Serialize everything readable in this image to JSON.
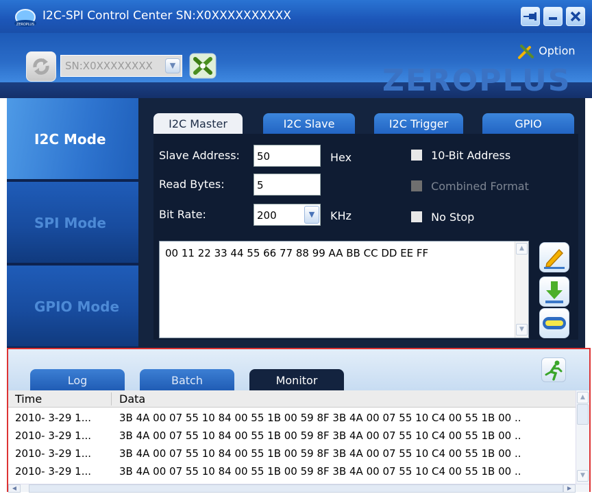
{
  "window": {
    "title": "I2C-SPI Control Center SN:X0XXXXXXXXXX",
    "pin_icon": "pin-icon",
    "minimize_icon": "minimize-icon",
    "close_icon": "close-icon"
  },
  "header": {
    "serial_select_value": "SN:X0XXXXXXXX",
    "option_label": "Option",
    "brand": "ZEROPLUS",
    "refresh_icon": "refresh-icon",
    "disconnect_icon": "disconnect-icon",
    "option_icon": "tools-icon"
  },
  "modes": [
    {
      "label": "I2C Mode",
      "active": true
    },
    {
      "label": "SPI Mode",
      "active": false
    },
    {
      "label": "GPIO Mode",
      "active": false
    }
  ],
  "tabs": [
    {
      "label": "I2C Master",
      "active": true
    },
    {
      "label": "I2C Slave",
      "active": false
    },
    {
      "label": "I2C Trigger",
      "active": false
    },
    {
      "label": "GPIO",
      "active": false
    }
  ],
  "form": {
    "slave_address_label": "Slave Address:",
    "slave_address_value": "50",
    "slave_address_unit": "Hex",
    "read_bytes_label": "Read Bytes:",
    "read_bytes_value": "5",
    "bit_rate_label": "Bit Rate:",
    "bit_rate_value": "200",
    "bit_rate_unit": "KHz",
    "ten_bit_label": "10-Bit Address",
    "ten_bit_checked": false,
    "combined_format_label": "Combined Format",
    "combined_format_enabled": false,
    "no_stop_label": "No Stop",
    "no_stop_checked": false,
    "data_text": "00 11 22 33 44 55 66 77 88 99 AA BB CC DD EE FF",
    "write_icon": "pencil-icon",
    "read_icon": "download-arrow-icon",
    "stop_icon": "stop-bar-icon"
  },
  "bottom": {
    "tabs": [
      {
        "label": "Log",
        "active": false
      },
      {
        "label": "Batch",
        "active": false
      },
      {
        "label": "Monitor",
        "active": true
      }
    ],
    "run_icon": "running-man-icon",
    "columns": [
      "Time",
      "Data"
    ],
    "rows": [
      {
        "time": "2010- 3-29 1...",
        "data": "3B 4A 00 07 55 10 84 00 55 1B 00 59 8F 3B 4A 00 07 55 10 C4 00 55 1B 00 .."
      },
      {
        "time": "2010- 3-29 1...",
        "data": "3B 4A 00 07 55 10 84 00 55 1B 00 59 8F 3B 4A 00 07 55 10 C4 00 55 1B 00 .."
      },
      {
        "time": "2010- 3-29 1...",
        "data": "3B 4A 00 07 55 10 84 00 55 1B 00 59 8F 3B 4A 00 07 55 10 C4 00 55 1B 00 .."
      },
      {
        "time": "2010- 3-29 1...",
        "data": "3B 4A 00 07 55 10 84 00 55 1B 00 59 8F 3B 4A 00 07 55 10 C4 00 55 1B 00 .."
      }
    ]
  },
  "colors": {
    "accent": "#2a6cc8",
    "dark_panel": "#0f1c33",
    "highlight_border": "#dd3333"
  }
}
